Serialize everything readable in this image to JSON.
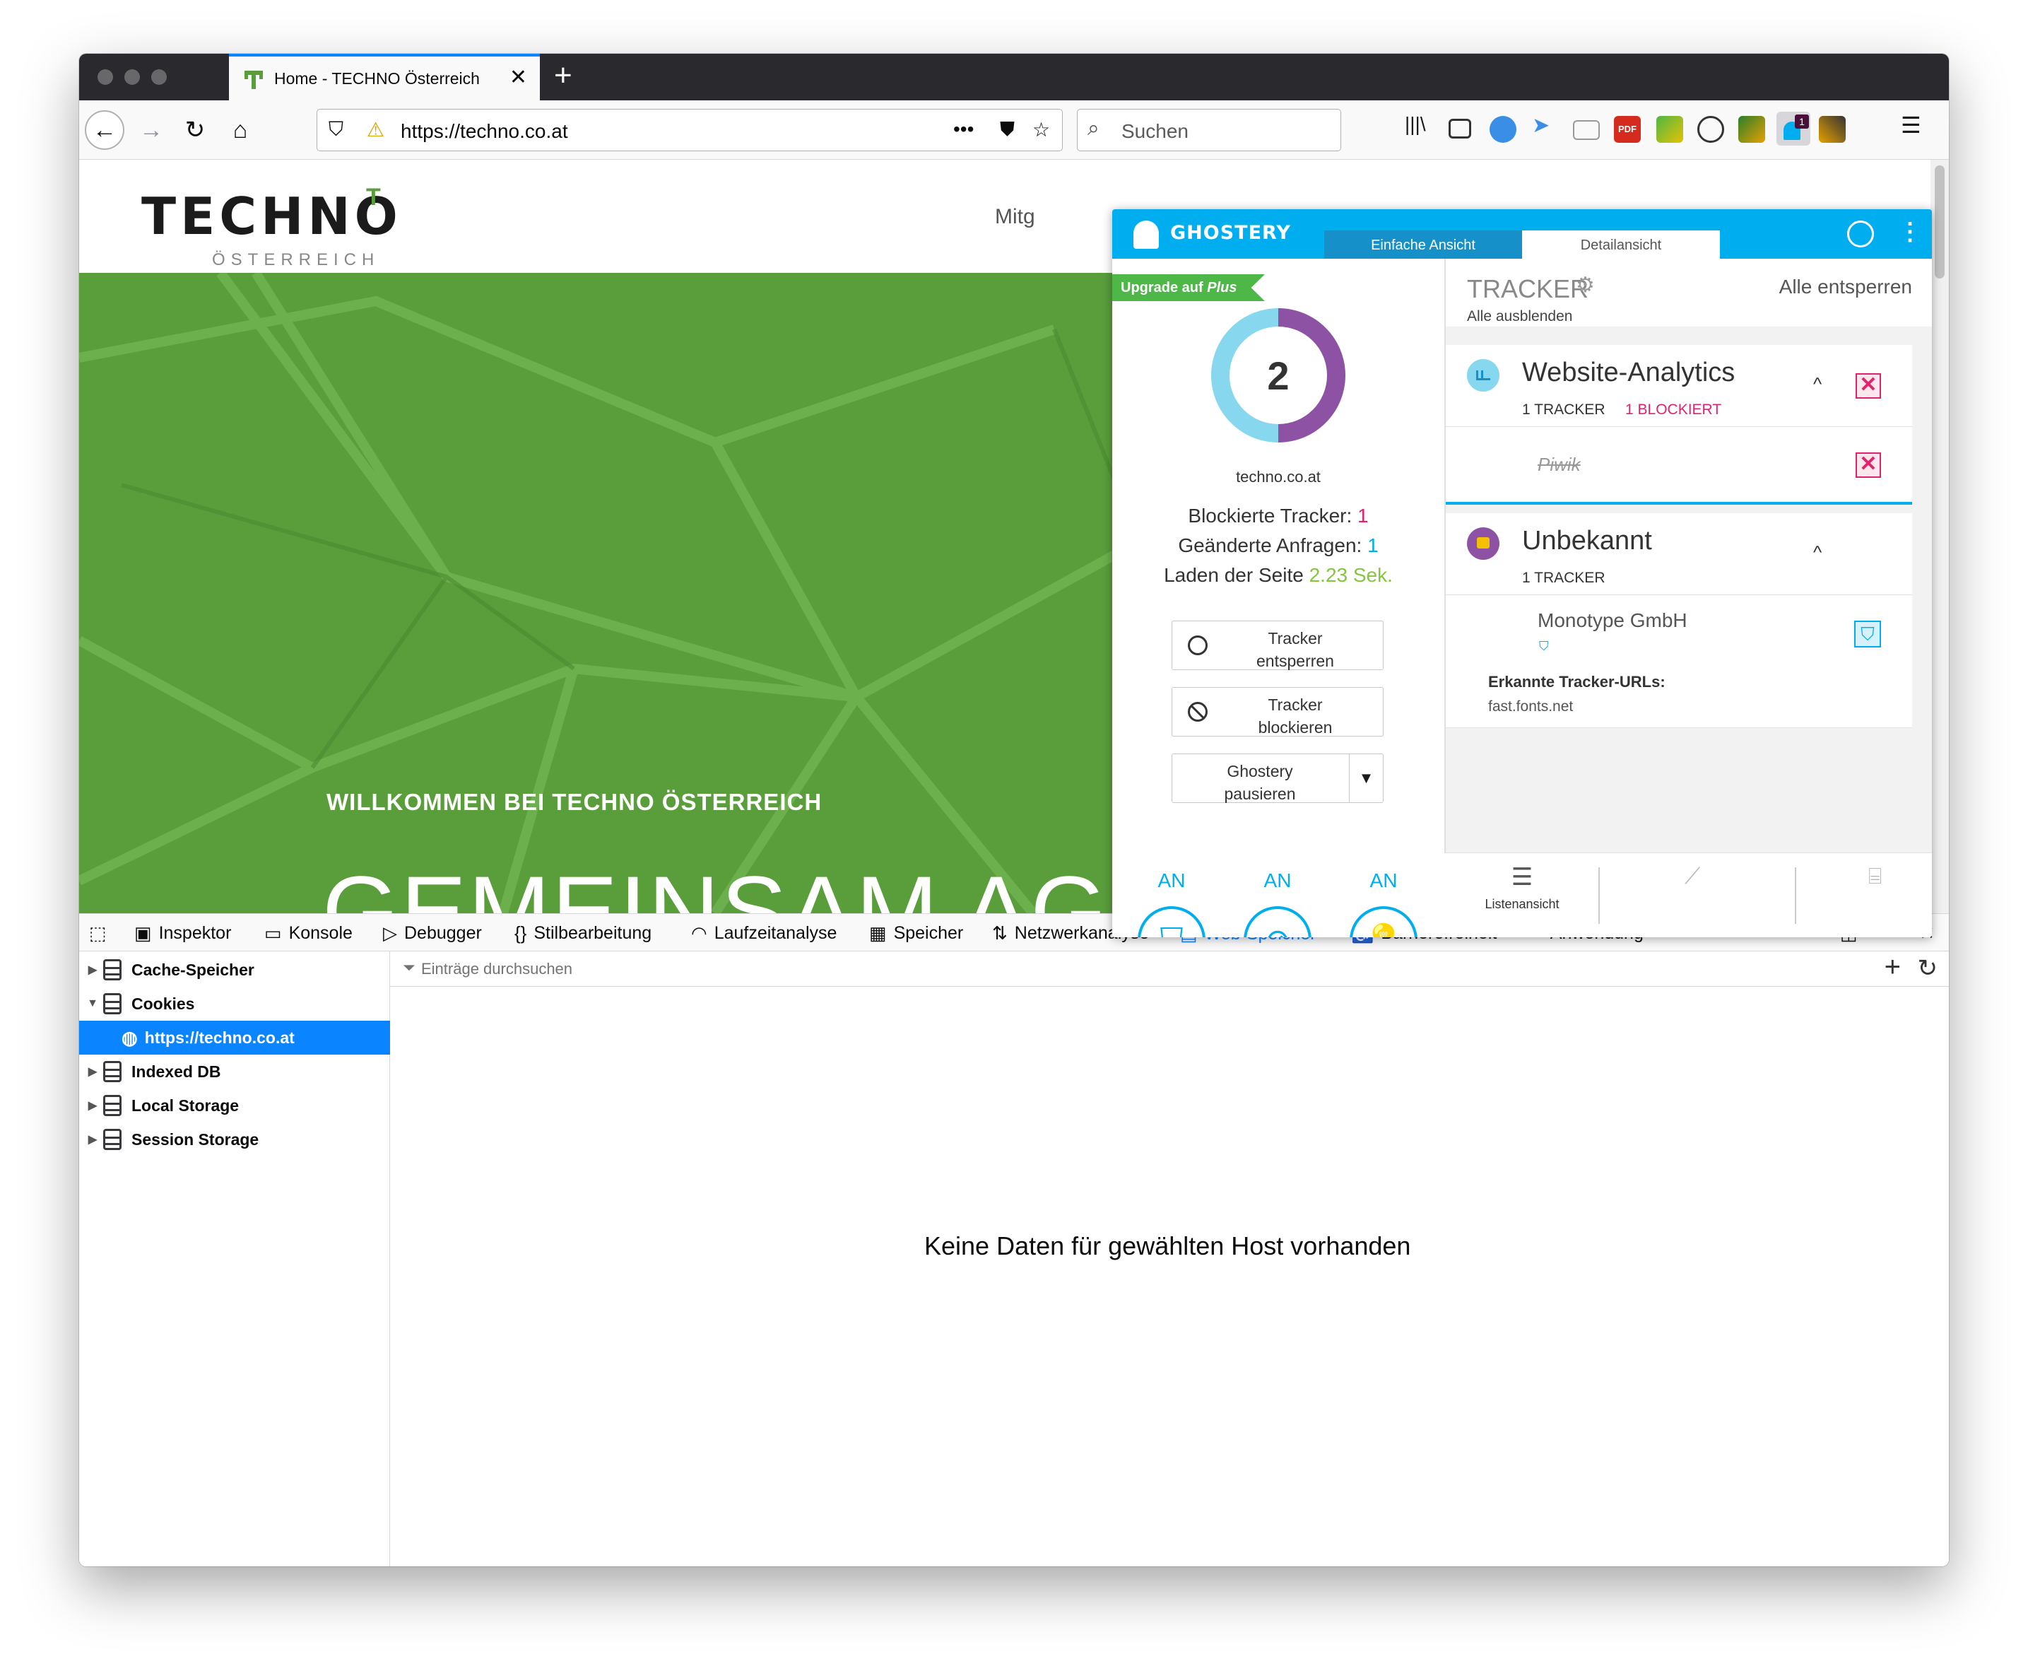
{
  "browser": {
    "tab_title": "Home - TECHNO Österreich",
    "url": "https://techno.co.at",
    "search_placeholder": "Suchen",
    "more_actions": "•••"
  },
  "page": {
    "logo_word": "TECHNO",
    "logo_sub": "ÖSTERREICH",
    "nav_partial": "Mitg",
    "welcome": "WILLKOMMEN BEI TECHNO ÖSTERREICH",
    "headline": "GEMEINSAM AGIEREN –",
    "hero_color": "#5a9e3c"
  },
  "ghostery": {
    "brand": "GHOSTERY",
    "tab_simple": "Einfache Ansicht",
    "tab_detail": "Detailansicht",
    "upgrade": "Upgrade auf",
    "upgrade_plus": "Plus",
    "tracker_count": "2",
    "domain": "techno.co.at",
    "blocked_label": "Blockierte Tracker:",
    "blocked_value": "1",
    "modified_label": "Geänderte Anfragen:",
    "modified_value": "1",
    "load_label": "Laden der Seite",
    "load_value": "2.23 Sek.",
    "btn_trust_1": "Tracker",
    "btn_trust_2": "entsperren",
    "btn_block_1": "Tracker",
    "btn_block_2": "blockieren",
    "btn_pause_1": "Ghostery",
    "btn_pause_2": "pausieren",
    "toggles": [
      "AN",
      "AN",
      "AN"
    ],
    "tracker_heading": "TRACKER",
    "unblock_all": "Alle entsperren",
    "hide_all": "Alle ausblenden",
    "cat1_title": "Website-Analytics",
    "cat1_count": "1 TRACKER",
    "cat1_blocked": "1 BLOCKIERT",
    "cat1_item": "Piwik",
    "cat2_title": "Unbekannt",
    "cat2_count": "1 TRACKER",
    "cat2_item": "Monotype GmbH",
    "urls_label": "Erkannte Tracker-URLs:",
    "urls_value": "fast.fonts.net",
    "footer_list": "Listenansicht",
    "colors": {
      "blue": "#00aef0",
      "purple": "#8e52a5",
      "light_blue": "#87d7ef",
      "red": "#e0236c",
      "green": "#4db748"
    }
  },
  "devtools": {
    "tabs": [
      "Inspektor",
      "Konsole",
      "Debugger",
      "Stilbearbeitung",
      "Laufzeitanalyse",
      "Speicher",
      "Netzwerkanalyse",
      "Web-Speicher",
      "Barrierefreiheit",
      "Anwendung"
    ],
    "active_tab": "Web-Speicher",
    "tree": [
      "Cache-Speicher",
      "Cookies",
      "https://techno.co.at",
      "Indexed DB",
      "Local Storage",
      "Session Storage"
    ],
    "filter_placeholder": "Einträge durchsuchen",
    "empty_message": "Keine Daten für gewählten Host vorhanden"
  }
}
